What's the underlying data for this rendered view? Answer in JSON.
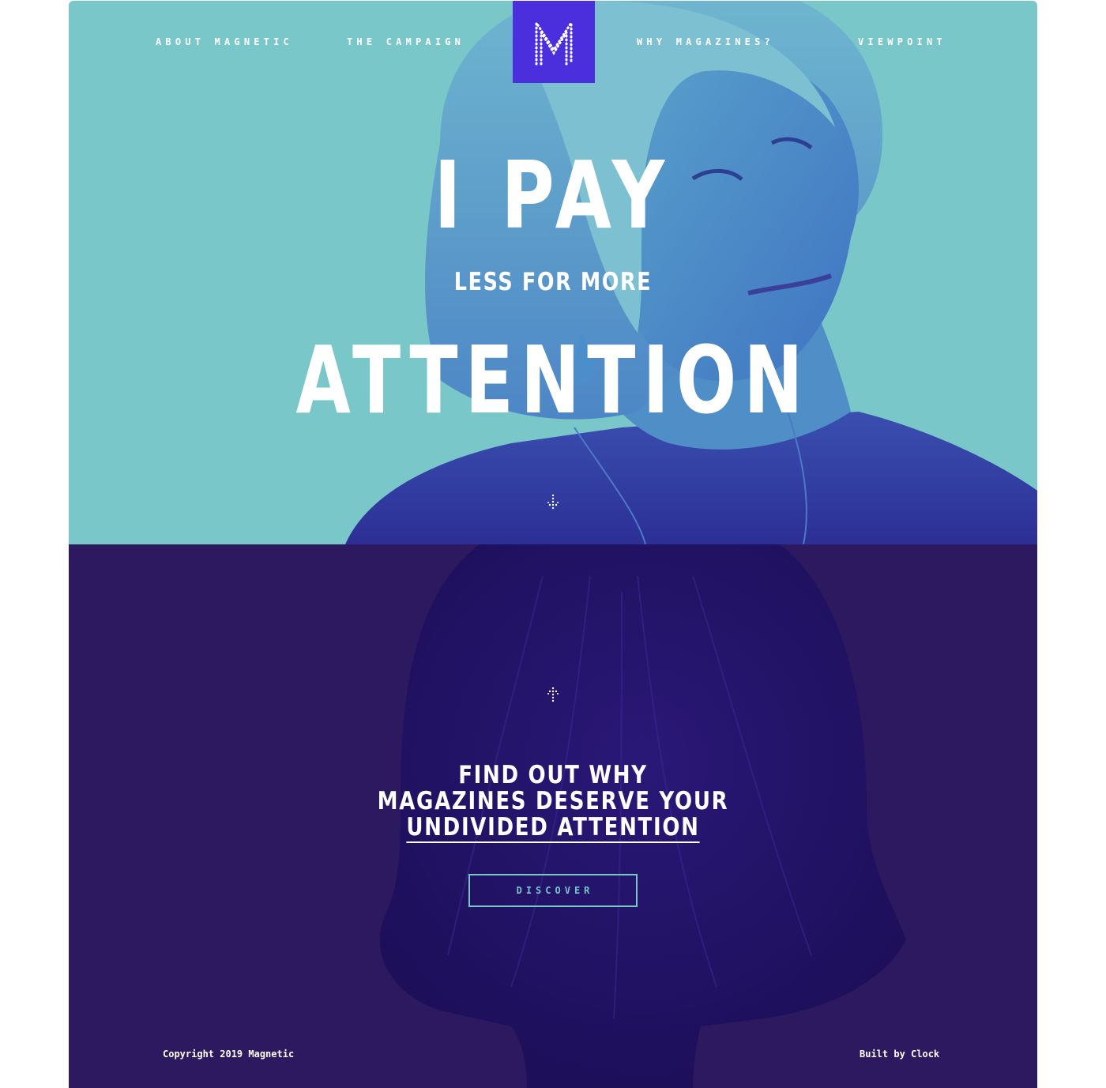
{
  "nav": {
    "items": [
      {
        "label": "ABOUT MAGNETIC"
      },
      {
        "label": "THE CAMPAIGN"
      },
      {
        "label": "WHY MAGAZINES?"
      },
      {
        "label": "VIEWPOINT"
      }
    ],
    "logo_letter": "M",
    "logo_icon": "magnetic-m-logo-icon"
  },
  "hero": {
    "headline_top": "I PAY",
    "headline_middle": "LESS FOR MORE",
    "headline_bottom": "ATTENTION",
    "scroll_icon": "dotted-arrow-down-icon"
  },
  "lower": {
    "scroll_icon": "dotted-arrow-up-icon",
    "cta_line_1": "FIND OUT WHY",
    "cta_line_2": "MAGAZINES DESERVE YOUR",
    "cta_line_3": "UNDIVIDED ATTENTION",
    "button_label": "DISCOVER"
  },
  "footer": {
    "copyright": "Copyright 2019 Magnetic",
    "credit": "Built by Clock"
  },
  "colors": {
    "hero_bg": "#79c7c9",
    "lower_bg": "#2c1960",
    "logo_bg": "#4b2fdc",
    "accent": "#79c7c9",
    "text": "#ffffff"
  }
}
